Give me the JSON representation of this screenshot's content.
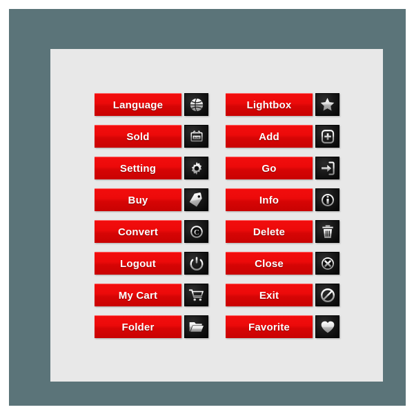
{
  "page": {
    "title": "Red Web Buttons Icon Set",
    "frame_color": "#5b7479",
    "panel_color": "#e8e8e8",
    "button_red_top": "#f20d0d",
    "button_red_bottom": "#c90202",
    "icon_box_color": "#111111",
    "label_color": "#ffffff"
  },
  "columns": [
    {
      "name": "left-column",
      "buttons": [
        {
          "label": "Language",
          "icon": "globe-icon"
        },
        {
          "label": "Sold",
          "icon": "sold-sign-icon"
        },
        {
          "label": "Setting",
          "icon": "gear-icon"
        },
        {
          "label": "Buy",
          "icon": "price-tag-icon"
        },
        {
          "label": "Convert",
          "icon": "copyright-icon"
        },
        {
          "label": "Logout",
          "icon": "power-icon"
        },
        {
          "label": "My Cart",
          "icon": "shopping-cart-icon"
        },
        {
          "label": "Folder",
          "icon": "folder-open-icon"
        }
      ]
    },
    {
      "name": "right-column",
      "buttons": [
        {
          "label": "Lightbox",
          "icon": "star-icon"
        },
        {
          "label": "Add",
          "icon": "plus-box-icon"
        },
        {
          "label": "Go",
          "icon": "enter-arrow-icon"
        },
        {
          "label": "Info",
          "icon": "info-circle-icon"
        },
        {
          "label": "Delete",
          "icon": "trash-can-icon"
        },
        {
          "label": "Close",
          "icon": "close-x-circle-icon"
        },
        {
          "label": "Exit",
          "icon": "prohibition-sign-icon"
        },
        {
          "label": "Favorite",
          "icon": "heart-icon"
        }
      ]
    }
  ]
}
